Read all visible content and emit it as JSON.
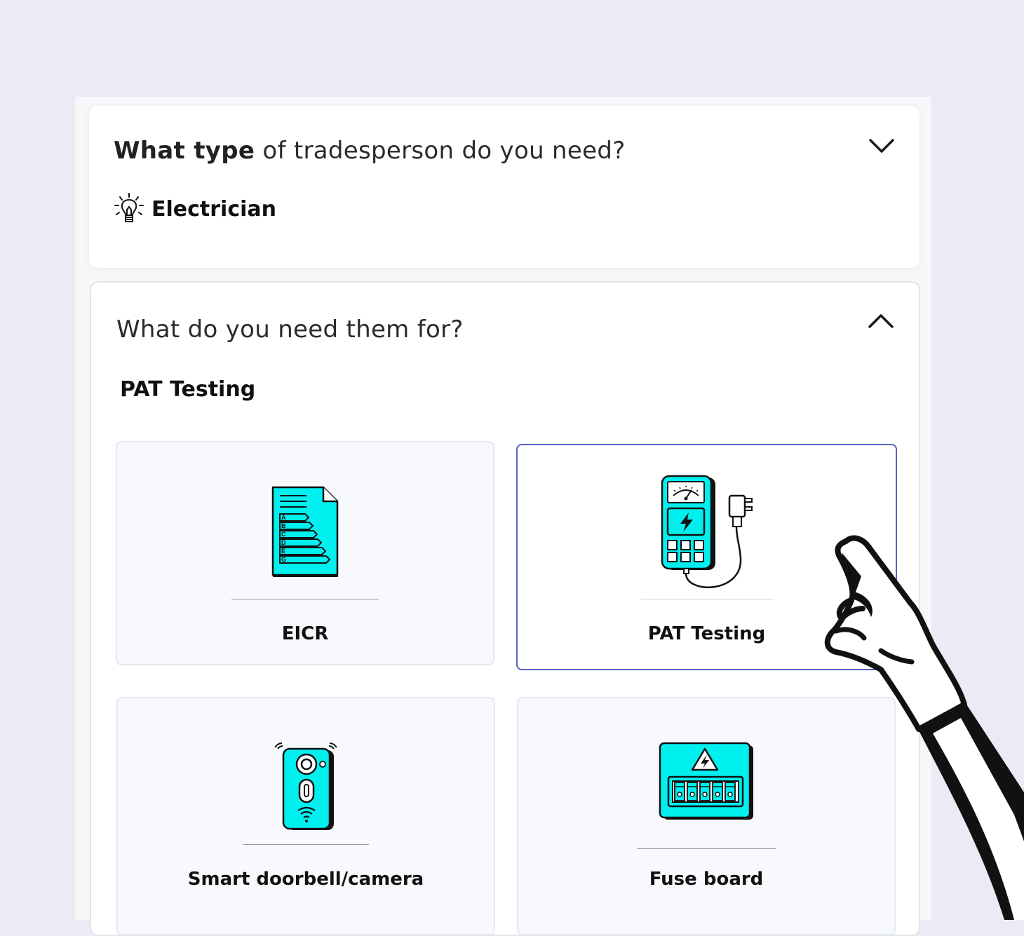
{
  "question1": {
    "bold": "What type",
    "rest": " of tradesperson do you need?",
    "answer": "Electrician",
    "answer_icon": "lightbulb-icon",
    "toggle_icon": "chevron-down-icon"
  },
  "question2": {
    "text": "What do you need them for?",
    "selected": "PAT Testing",
    "toggle_icon": "chevron-up-icon"
  },
  "options": [
    {
      "label": "EICR",
      "icon": "energy-rating-document-icon",
      "selected": false
    },
    {
      "label": "PAT Testing",
      "icon": "pat-tester-icon",
      "selected": true
    },
    {
      "label": "Smart doorbell/camera",
      "icon": "smart-doorbell-icon",
      "selected": false
    },
    {
      "label": "Fuse board",
      "icon": "fuse-board-icon",
      "selected": false
    }
  ],
  "energy_grades": [
    "A",
    "B",
    "C",
    "D",
    "E",
    "G"
  ],
  "colors": {
    "accent": "#00f0f0",
    "selected_border": "#5561c7",
    "background": "#ebebf6"
  }
}
